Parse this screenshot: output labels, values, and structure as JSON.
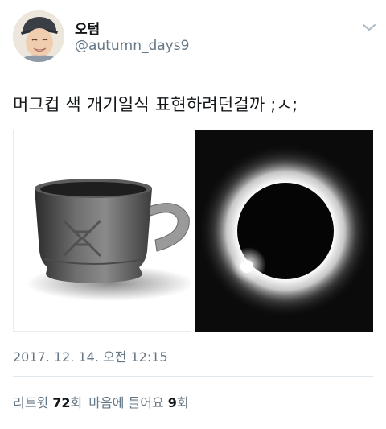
{
  "user": {
    "display_name": "오텀",
    "handle": "@autumn_days9"
  },
  "tweet": {
    "text": "머그컵 색 개기일식 표현하려던걸까 ;ㅅ;",
    "timestamp": "2017. 12. 14. 오전 12:15"
  },
  "stats": {
    "retweet_label": "리트윗",
    "retweet_count": "72",
    "retweet_unit": "회",
    "like_label": "마음에 들어요",
    "like_count": "9",
    "like_unit": "회"
  },
  "icons": {
    "menu": "chevron-down-icon"
  },
  "colors": {
    "secondary_text": "#657786",
    "primary_text": "#14171a",
    "divider": "#e1e8ed"
  }
}
